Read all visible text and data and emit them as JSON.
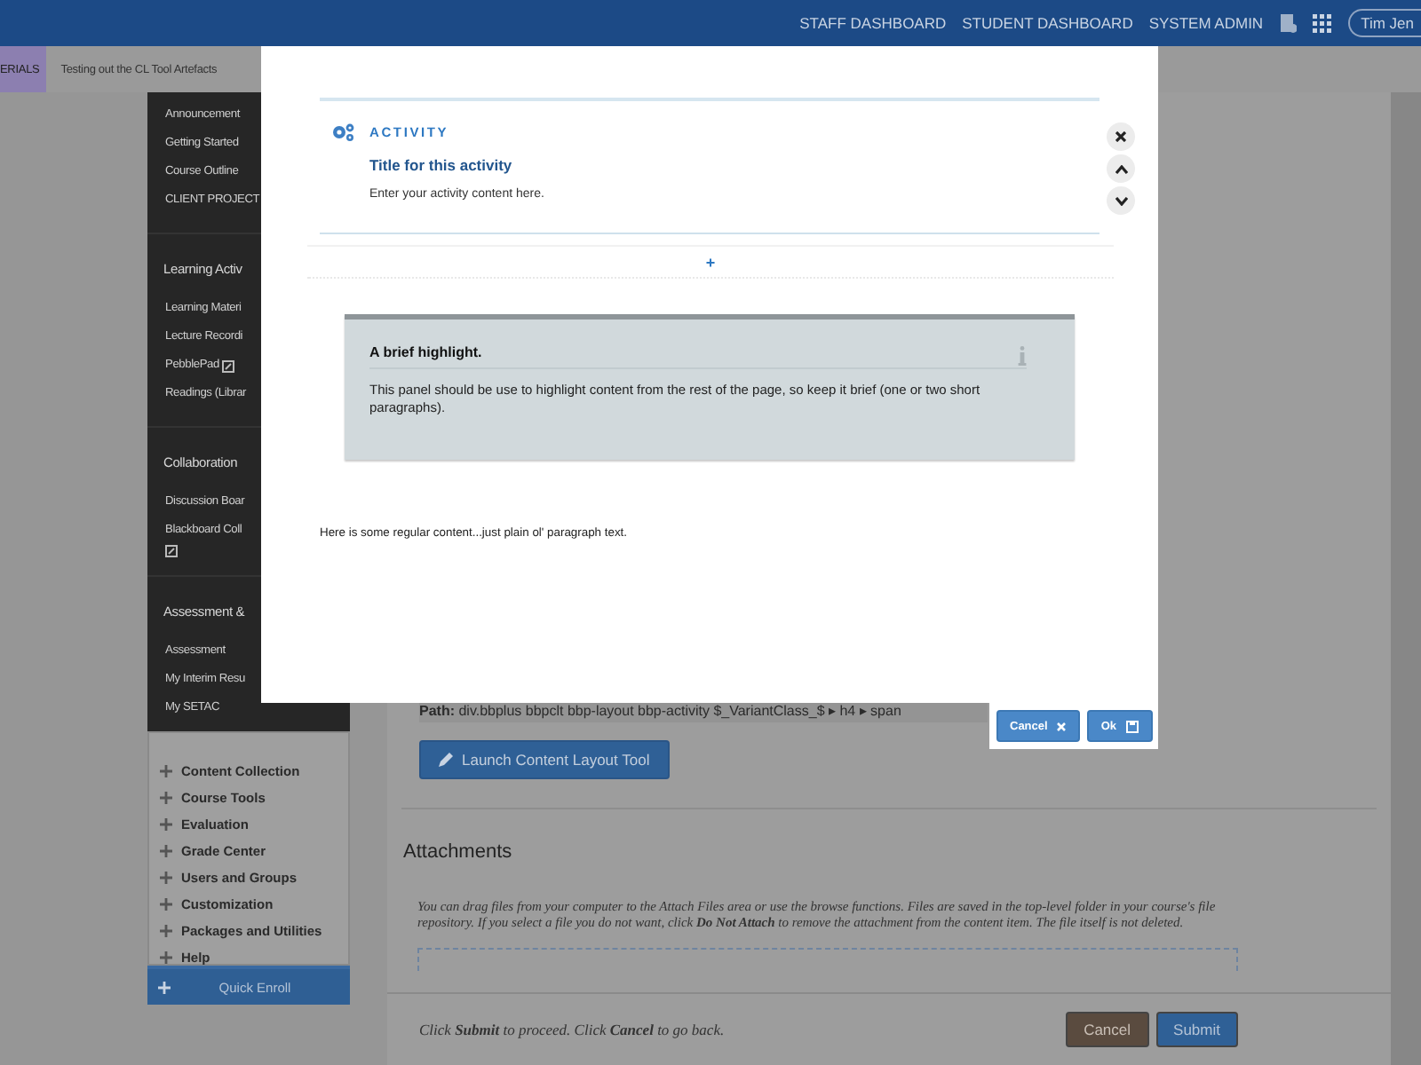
{
  "top_bar": {
    "links": [
      "STAFF DASHBOARD",
      "STUDENT DASHBOARD",
      "SYSTEM ADMIN"
    ],
    "user": "Tim Jen"
  },
  "breadcrumbs": [
    {
      "label": "ERIALS",
      "selected": true
    },
    {
      "label": "Testing out the CL Tool Artefacts",
      "selected": false
    }
  ],
  "sidebar": {
    "sections": [
      {
        "items": [
          {
            "label": "Announcement",
            "kind": "link"
          },
          {
            "label": "Getting Started",
            "kind": "link"
          },
          {
            "label": "Course Outline",
            "kind": "link"
          },
          {
            "label": "CLIENT PROJECT",
            "kind": "link"
          }
        ]
      },
      {
        "heading": "Learning Activ",
        "items": [
          {
            "label": "Learning Materi",
            "kind": "link"
          },
          {
            "label": "Lecture Recordi",
            "kind": "link"
          },
          {
            "label": "PebblePad",
            "kind": "external"
          },
          {
            "label": "Readings (Librar",
            "kind": "link"
          }
        ]
      },
      {
        "heading": "Collaboration",
        "items": [
          {
            "label": "Discussion Boar",
            "kind": "link"
          },
          {
            "label": "Blackboard Coll",
            "kind": "external"
          }
        ]
      },
      {
        "heading": "Assessment &",
        "items": [
          {
            "label": "Assessment",
            "kind": "link"
          },
          {
            "label": "My Interim Resu",
            "kind": "link"
          },
          {
            "label": "My SETAC",
            "kind": "link"
          }
        ]
      }
    ],
    "tools": [
      "Content Collection",
      "Course Tools",
      "Evaluation",
      "Grade Center",
      "Users and Groups",
      "Customization",
      "Packages and Utilities",
      "Help"
    ],
    "quick_enroll": "Quick Enroll"
  },
  "main": {
    "path": "**Path:** div.bbplus bbpclt bbp-layout bbp-activity $_VariantClass_$ ▸ h4 ▸ span",
    "launch_button": "Launch Content Layout Tool",
    "attachments_heading": "Attachments",
    "attachments_text": "You can drag files from your computer to the Attach Files area or use the browse functions. Files are saved in the top-level folder in your course's file repository.  If you select a file you do not want, click **Do Not Attach** to remove the attachment from the content item. The file itself is not deleted.",
    "footer_text": "Click **Submit** to proceed. Click **Cancel** to go back.",
    "buttons": [
      {
        "label": "Cancel",
        "kind": "secondary"
      },
      {
        "label": "Submit",
        "kind": "primary"
      }
    ]
  },
  "modal": {
    "activity": {
      "label": "ACTIVITY",
      "title": "Title for this activity",
      "body": "Enter your activity content here."
    },
    "add_button": "+",
    "highlight": {
      "title": "A brief highlight.",
      "body": "This panel should be use to highlight content from the rest of the page, so keep it brief (one or two short paragraphs)."
    },
    "paragraph": "Here is some regular content...just plain ol' paragraph text.",
    "buttons": [
      {
        "label": "Cancel",
        "kind": "cancel"
      },
      {
        "label": "Ok",
        "kind": "ok"
      }
    ]
  }
}
